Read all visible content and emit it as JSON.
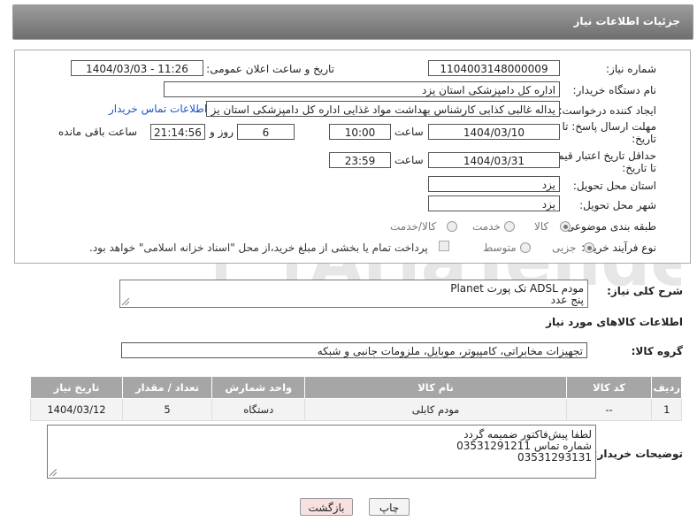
{
  "header": {
    "title": "جزئیات اطلاعات نیاز"
  },
  "form": {
    "need_number_label": "شماره نیاز:",
    "need_number": "1104003148000009",
    "announce_label": "تاریخ و ساعت اعلان عمومی:",
    "announce_value": "1404/03/03 - 11:26",
    "buyer_org_label": "نام دستگاه خریدار:",
    "buyer_org": "اداره کل دامپزشکی استان یزد",
    "creator_label": "ایجاد کننده درخواست:",
    "creator": "یداله غالبی کذابی کارشناس بهداشت مواد غذایی اداره کل دامپزشکی استان یز",
    "buyer_contact_link": "اطلاعات تماس خریدار",
    "deadline_label_1": "مهلت ارسال پاسخ: تا",
    "deadline_label_2": "تاریخ:",
    "deadline_date": "1404/03/10",
    "time_label": "ساعت",
    "deadline_time": "10:00",
    "days_value": "6",
    "days_label": "روز و",
    "remaining_value": "21:14:56",
    "remaining_label": "ساعت باقی مانده",
    "min_valid_label_1": "حداقل تاریخ اعتبار قیمت:",
    "min_valid_label_2": "تا تاریخ:",
    "min_valid_date": "1404/03/31",
    "min_valid_time": "23:59",
    "province_label": "استان محل تحویل:",
    "province": "یزد",
    "city_label": "شهر محل تحویل:",
    "city": "یزد",
    "category_label": "طبقه بندی موضوعی:",
    "category_options": [
      "کالا",
      "خدمت",
      "کالا/خدمت"
    ],
    "process_label": "نوع فرآیند خرید :",
    "process_options": [
      "جزیی",
      "متوسط"
    ],
    "payment_note": "پرداخت تمام یا بخشی از مبلغ خرید،از محل \"اسناد خزانه اسلامی\" خواهد بود."
  },
  "summary": {
    "label": "شرح کلی نیاز:",
    "line1": "مودم ADSL تک پورت Planet",
    "line2": "پنج عدد"
  },
  "goods": {
    "section_title": "اطلاعات کالاهای مورد نیاز",
    "group_label": "گروه کالا:",
    "group_value": "تجهیزات مخابراتی، کامپیوتر، موبایل، ملزومات جانبی و شبکه",
    "columns": [
      "ردیف",
      "کد کالا",
      "نام کالا",
      "واحد شمارش",
      "تعداد / مقدار",
      "تاریخ نیاز"
    ],
    "rows": [
      {
        "row": "1",
        "code": "--",
        "name": "مودم کابلی",
        "unit": "دستگاه",
        "qty": "5",
        "date": "1404/03/12"
      }
    ]
  },
  "notes": {
    "label": "توضیحات خریدار:",
    "line1": "لطفا پیش‌فاکتور ضمیمه گردد",
    "line2": "شماره تماس 03531291211",
    "line3": "03531293131"
  },
  "buttons": {
    "print": "چاپ",
    "back": "بازگشت"
  },
  "watermark": {
    "text": "AriaTender.neT"
  },
  "colors": {
    "header_bg": "#7f7f7f",
    "table_header": "#a6a6a6",
    "link": "#1a56c8",
    "back_button": "#f8e0e0"
  }
}
